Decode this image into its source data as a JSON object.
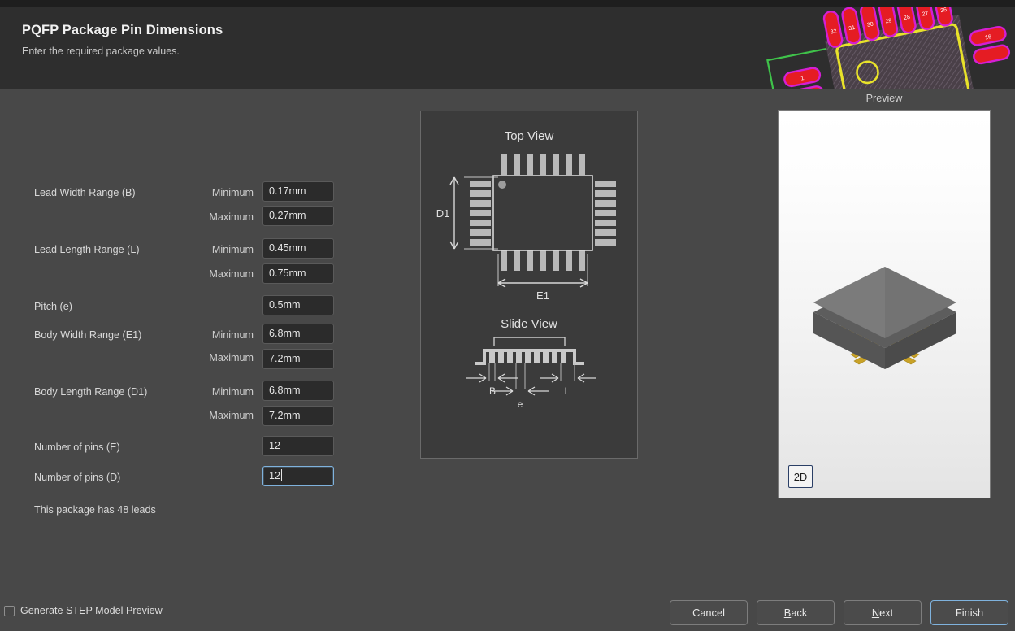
{
  "header": {
    "title": "PQFP Package Pin Dimensions",
    "subtitle": "Enter the required package values.",
    "artwork": {
      "name": "pcb-footprint-artwork",
      "pad_labels": [
        "1",
        "32",
        "31",
        "30",
        "29",
        "28",
        "27",
        "26"
      ],
      "colors": {
        "pad_fill": "#e51c23",
        "pad_outline": "#d41fd4",
        "courtyard": "#e8e22a",
        "outline": "#3fc24a",
        "background": "#2e2e2e"
      }
    }
  },
  "form": {
    "rows": [
      {
        "label": "Lead Width Range (B)",
        "minmax": "Minimum",
        "value": "0.17mm",
        "focused": false
      },
      {
        "label": "",
        "minmax": "Maximum",
        "value": "0.27mm",
        "focused": false
      },
      {
        "label": "Lead Length Range (L)",
        "minmax": "Minimum",
        "value": "0.45mm",
        "focused": false
      },
      {
        "label": "",
        "minmax": "Maximum",
        "value": "0.75mm",
        "focused": false
      },
      {
        "label": "Pitch (e)",
        "minmax": "",
        "value": "0.5mm",
        "focused": false
      },
      {
        "label": "Body Width Range (E1)",
        "minmax": "Minimum",
        "value": "6.8mm",
        "focused": false
      },
      {
        "label": "",
        "minmax": "Maximum",
        "value": "7.2mm",
        "focused": false
      },
      {
        "label": "Body Length Range (D1)",
        "minmax": "Minimum",
        "value": "6.8mm",
        "focused": false
      },
      {
        "label": "",
        "minmax": "Maximum",
        "value": "7.2mm",
        "focused": false
      },
      {
        "label": "Number of pins (E)",
        "minmax": "",
        "value": "12",
        "focused": false
      },
      {
        "label": "Number of pins (D)",
        "minmax": "",
        "value": "12",
        "focused": true
      }
    ],
    "lead_count_note": "This package has 48 leads"
  },
  "diagram": {
    "top_view": {
      "title": "Top View",
      "height_dim_label": "D1",
      "width_dim_label": "E1",
      "pins_per_side": 7
    },
    "slide_view": {
      "title": "Slide View",
      "dim_labels": [
        "B",
        "e",
        "L"
      ],
      "lead_count": 11
    }
  },
  "preview": {
    "label": "Preview",
    "toggle_label": "2D",
    "model": {
      "name": "qfp-3d-model",
      "body_color": "#6e6e6e",
      "lead_color": "#c9a227"
    }
  },
  "footer": {
    "checkbox": {
      "label": "Generate STEP Model Preview",
      "checked": false
    },
    "buttons": [
      {
        "label": "Cancel",
        "mnemonic": "",
        "default": false
      },
      {
        "label": "Back",
        "mnemonic": "B",
        "default": false
      },
      {
        "label": "Next",
        "mnemonic": "N",
        "default": false
      },
      {
        "label": "Finish",
        "mnemonic": "",
        "default": true
      }
    ]
  }
}
